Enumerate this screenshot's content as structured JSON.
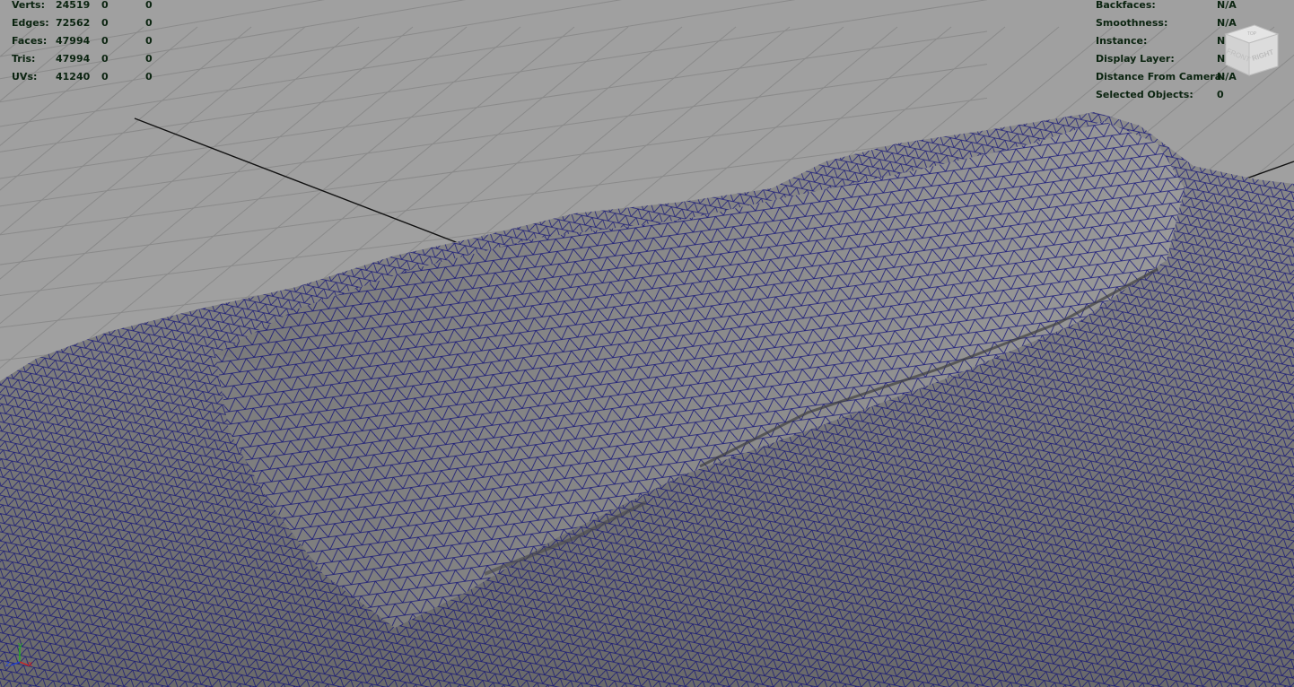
{
  "stats": [
    {
      "label": "Verts:",
      "values": [
        "24519",
        "0",
        "0"
      ]
    },
    {
      "label": "Edges:",
      "values": [
        "72562",
        "0",
        "0"
      ]
    },
    {
      "label": "Faces:",
      "values": [
        "47994",
        "0",
        "0"
      ]
    },
    {
      "label": "Tris:",
      "values": [
        "47994",
        "0",
        "0"
      ]
    },
    {
      "label": "UVs:",
      "values": [
        "41240",
        "0",
        "0"
      ]
    }
  ],
  "properties": [
    {
      "label": "Backfaces:",
      "value": "N/A"
    },
    {
      "label": "Smoothness:",
      "value": "N/A"
    },
    {
      "label": "Instance:",
      "value": "N/A"
    },
    {
      "label": "Display Layer:",
      "value": "N/A"
    },
    {
      "label": "Distance From Camera:",
      "value": "N/A"
    },
    {
      "label": "Selected Objects:",
      "value": "0"
    }
  ],
  "view_cube": {
    "front": "FRONT",
    "right": "RIGHT",
    "top": "TOP"
  },
  "axis": {
    "x": "x",
    "y": "y",
    "z": "z"
  },
  "colors": {
    "background": "#a0a0a0",
    "grid": "#8a8a8a",
    "mesh_fill": "#808080",
    "wireframe": "#0a0a78",
    "hud_text": "#0b2410",
    "axis_x": "#d02020",
    "axis_y": "#20b020",
    "axis_z": "#2040d0"
  }
}
